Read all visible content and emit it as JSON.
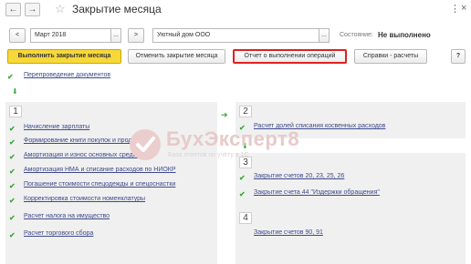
{
  "window": {
    "title": "Закрытие месяца",
    "back_icon": "←",
    "forward_icon": "→",
    "favorite_icon": "☆",
    "more_icon": "⋮",
    "close_icon": "×"
  },
  "period": {
    "prev": "<",
    "value": "Март 2018",
    "picker": "...",
    "next": ">"
  },
  "organization": {
    "value": "Уютный дом ООО",
    "picker": "..."
  },
  "state": {
    "label": "Состояние:",
    "value": "Не выполнено"
  },
  "toolbar": {
    "run": "Выполнить закрытие месяца",
    "cancel": "Отменить закрытие месяца",
    "report": "Отчет о выполнении операций",
    "help": "Справки - расчеты",
    "question": "?"
  },
  "repost_link": "Перепроведение документов",
  "stages": [
    {
      "number": "1",
      "items": [
        "Начисление зарплаты",
        "Формирование книги покупок и продаж",
        "Амортизация и износ основных средств",
        "Амортизация НМА и списание расходов по НИОКР",
        "Погашение стоимости спецодежды и спецоснастки",
        "Корректировка стоимости номенклатуры",
        "Расчет налога на имущество",
        "Расчет торгового сбора"
      ]
    },
    {
      "number": "2",
      "items": [
        "Расчет долей списания косвенных расходов"
      ]
    },
    {
      "number": "3",
      "items": [
        "Закрытие счетов 20, 23, 25, 26",
        "Закрытие счета 44 \"Издержки обращения\""
      ]
    },
    {
      "number": "4",
      "items": [
        "Закрытие счетов 90, 91"
      ]
    }
  ],
  "watermark": {
    "main": "БухЭксперт8",
    "sub": "База ответов по учёту в 1С"
  },
  "colors": {
    "accent_button": "#f7d83a",
    "report_highlight": "#e02020",
    "check": "#3aa93a",
    "link": "#3e4a8a",
    "panel": "#f0f0f0"
  }
}
